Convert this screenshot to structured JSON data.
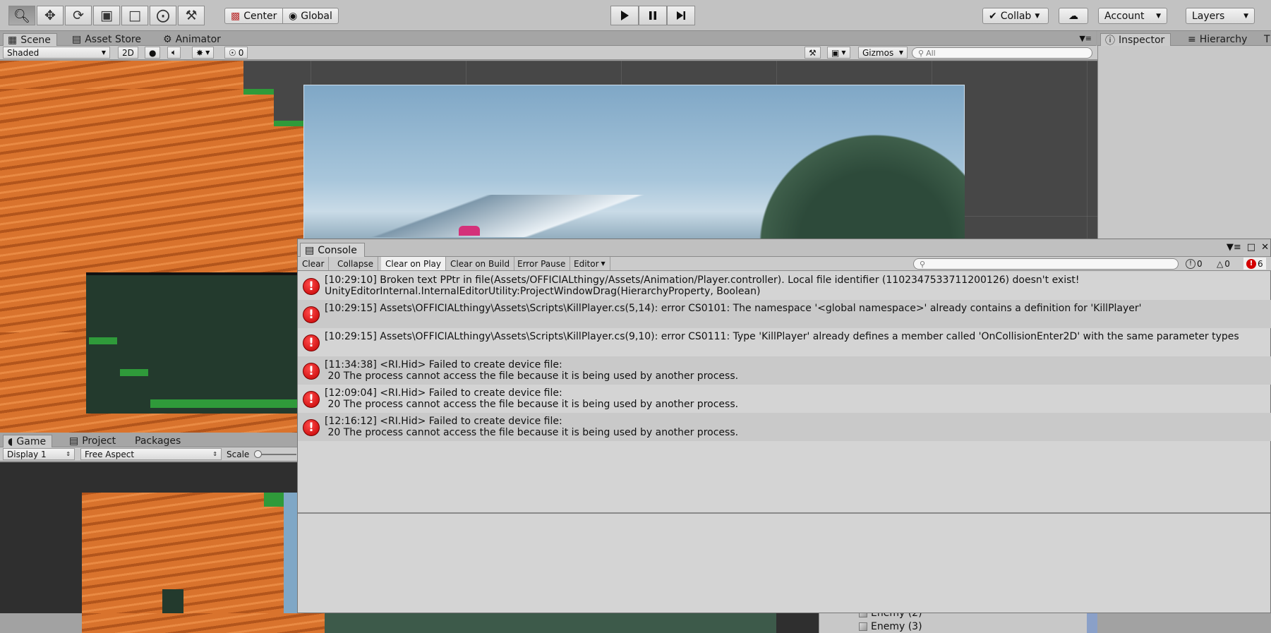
{
  "toolbar": {
    "pivot_center": "Center",
    "pivot_global": "Global",
    "collab": "Collab",
    "account": "Account",
    "layers": "Layers"
  },
  "scene": {
    "tabs": [
      "Scene",
      "Asset Store",
      "Animator"
    ],
    "shading_mode": "Shaded",
    "mode_2d": "2D",
    "hidden_count": "0",
    "gizmos": "Gizmos",
    "search_placeholder": "All"
  },
  "right_panel": {
    "tabs": [
      "Inspector",
      "Hierarchy",
      "T"
    ],
    "hierarchy_items": [
      "Enemy (2)",
      "Enemy (3)"
    ]
  },
  "game": {
    "tabs": [
      "Game",
      "Project",
      "Packages"
    ],
    "display": "Display 1",
    "aspect": "Free Aspect",
    "scale_label": "Scale"
  },
  "console": {
    "title": "Console",
    "buttons": [
      "Clear",
      "Collapse",
      "Clear on Play",
      "Clear on Build",
      "Error Pause",
      "Editor"
    ],
    "counts": {
      "info": "0",
      "warning": "0",
      "error": "6"
    },
    "messages": [
      {
        "line1": "[10:29:10] Broken text PPtr in file(Assets/OFFICIALthingy/Assets/Animation/Player.controller). Local file identifier (1102347533711200126) doesn't exist!",
        "line2": "UnityEditorInternal.InternalEditorUtility:ProjectWindowDrag(HierarchyProperty, Boolean)"
      },
      {
        "line1": "[10:29:15] Assets\\OFFICIALthingy\\Assets\\Scripts\\KillPlayer.cs(5,14): error CS0101: The namespace '<global namespace>' already contains a definition for 'KillPlayer'",
        "line2": ""
      },
      {
        "line1": "[10:29:15] Assets\\OFFICIALthingy\\Assets\\Scripts\\KillPlayer.cs(9,10): error CS0111: Type 'KillPlayer' already defines a member called 'OnCollisionEnter2D' with the same parameter types",
        "line2": ""
      },
      {
        "line1": "[11:34:38] <RI.Hid> Failed to create device file:",
        "line2": " 20 The process cannot access the file because it is being used by another process."
      },
      {
        "line1": "[12:09:04] <RI.Hid> Failed to create device file:",
        "line2": " 20 The process cannot access the file because it is being used by another process."
      },
      {
        "line1": "[12:16:12] <RI.Hid> Failed to create device file:",
        "line2": " 20 The process cannot access the file because it is being used by another process."
      }
    ]
  }
}
